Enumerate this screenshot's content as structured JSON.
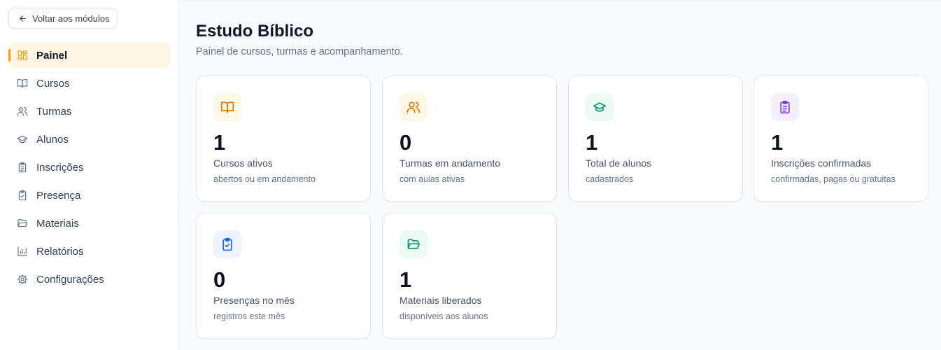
{
  "sidebar": {
    "back_label": "Voltar aos módulos",
    "items": [
      {
        "label": "Painel",
        "icon": "dashboard-icon"
      },
      {
        "label": "Cursos",
        "icon": "book-icon"
      },
      {
        "label": "Turmas",
        "icon": "users-icon"
      },
      {
        "label": "Alunos",
        "icon": "graduation-cap-icon"
      },
      {
        "label": "Inscrições",
        "icon": "clipboard-list-icon"
      },
      {
        "label": "Presença",
        "icon": "clipboard-check-icon"
      },
      {
        "label": "Materiais",
        "icon": "folder-open-icon"
      },
      {
        "label": "Relatórios",
        "icon": "bar-chart-icon"
      },
      {
        "label": "Configurações",
        "icon": "gear-icon"
      }
    ],
    "active_item": "Painel"
  },
  "header": {
    "title": "Estudo Bíblico",
    "subtitle": "Painel de cursos, turmas e acompanhamento."
  },
  "cards": [
    {
      "value": "1",
      "label": "Cursos ativos",
      "desc": "abertos ou em andamento",
      "icon": "book-icon",
      "color": "#d97706",
      "bg": "#fff7e6"
    },
    {
      "value": "0",
      "label": "Turmas em andamento",
      "desc": "com aulas ativas",
      "icon": "users-icon",
      "color": "#d97706",
      "bg": "#fff7e6"
    },
    {
      "value": "1",
      "label": "Total de alunos",
      "desc": "cadastrados",
      "icon": "graduation-cap-icon",
      "color": "#059669",
      "bg": "#ebfaf3"
    },
    {
      "value": "1",
      "label": "Inscrições confirmadas",
      "desc": "confirmadas, pagas ou gratuitas",
      "icon": "clipboard-list-icon",
      "color": "#7c3aed",
      "bg": "#f3efff"
    },
    {
      "value": "0",
      "label": "Presenças no mês",
      "desc": "registros este mês",
      "icon": "clipboard-check-icon",
      "color": "#2563eb",
      "bg": "#edf4ff"
    },
    {
      "value": "1",
      "label": "Materiais liberados",
      "desc": "disponíveis aos alunos",
      "icon": "folder-open-icon",
      "color": "#059669",
      "bg": "#ebfaf3"
    }
  ],
  "colors": {
    "accent": "#f59e0b",
    "active_bg": "#fff4e3",
    "page_bg": "#f8fafc"
  }
}
